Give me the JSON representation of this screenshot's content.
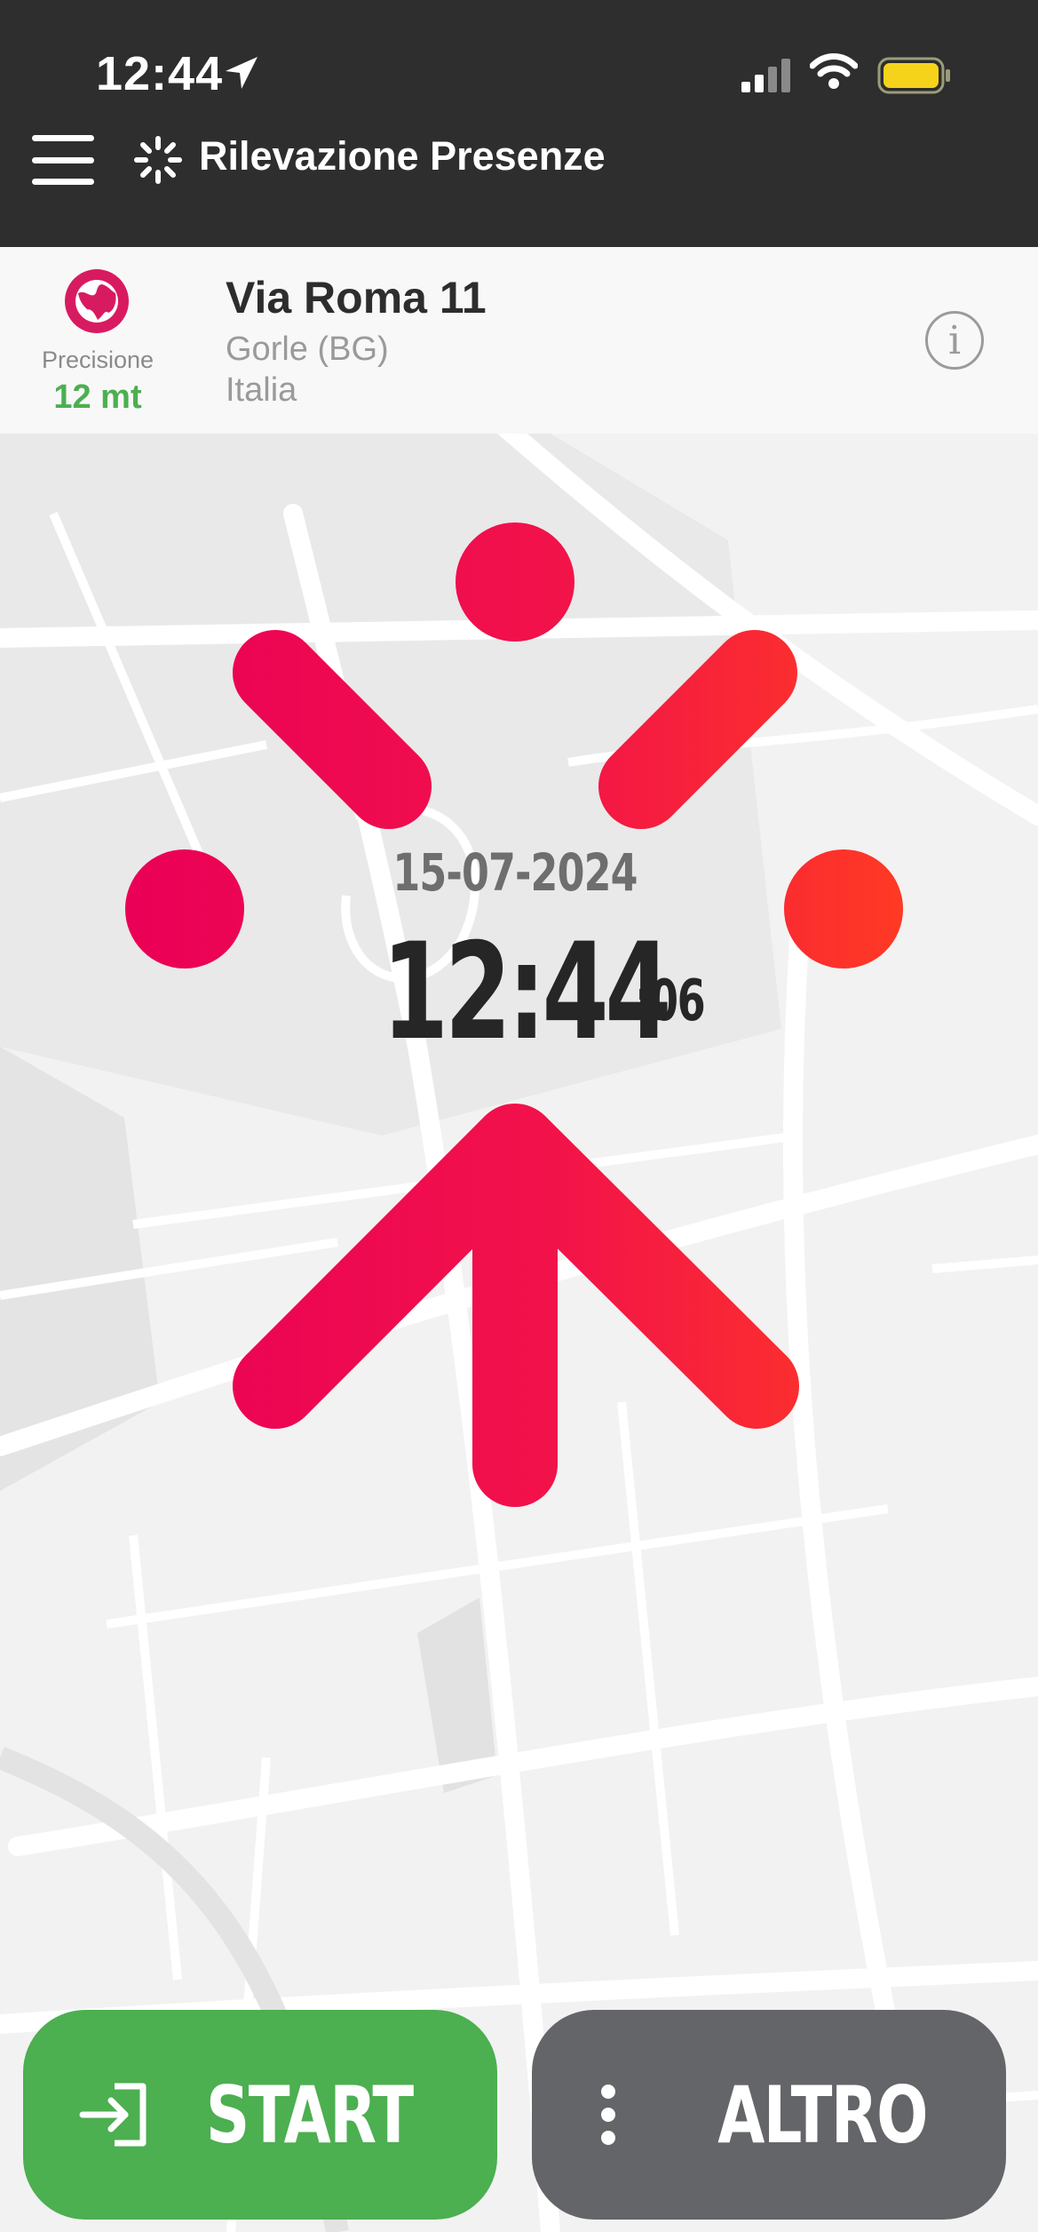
{
  "status_bar": {
    "time": "12:44",
    "icons": [
      "location-arrow-icon",
      "cellular-signal-icon",
      "wifi-icon",
      "battery-icon"
    ],
    "battery_color": "#f5d31a"
  },
  "header": {
    "title": "Rilevazione Presenze",
    "menu_icon": "hamburger-menu-icon",
    "logo_icon": "sparkle-logo-icon",
    "background": "#2e2e2e"
  },
  "location": {
    "precision_label": "Precisione",
    "precision_value": "12 mt",
    "street": "Via Roma 11",
    "city": "Gorle (BG)",
    "country": "Italia",
    "info_symbol": "i",
    "globe_icon": "globe-icon",
    "accent_color": "#d81b60",
    "precision_color": "#4caf50"
  },
  "clock": {
    "date": "15-07-2024",
    "time": "12:44",
    "seconds": ":06"
  },
  "graphic": {
    "gradient_start": "#ea0057",
    "gradient_end": "#ff3a23"
  },
  "actions": {
    "start_label": "START",
    "start_icon": "login-arrow-icon",
    "start_color": "#4caf50",
    "other_label": "ALTRO",
    "other_icon": "vertical-dots-icon",
    "other_color": "#646568"
  }
}
